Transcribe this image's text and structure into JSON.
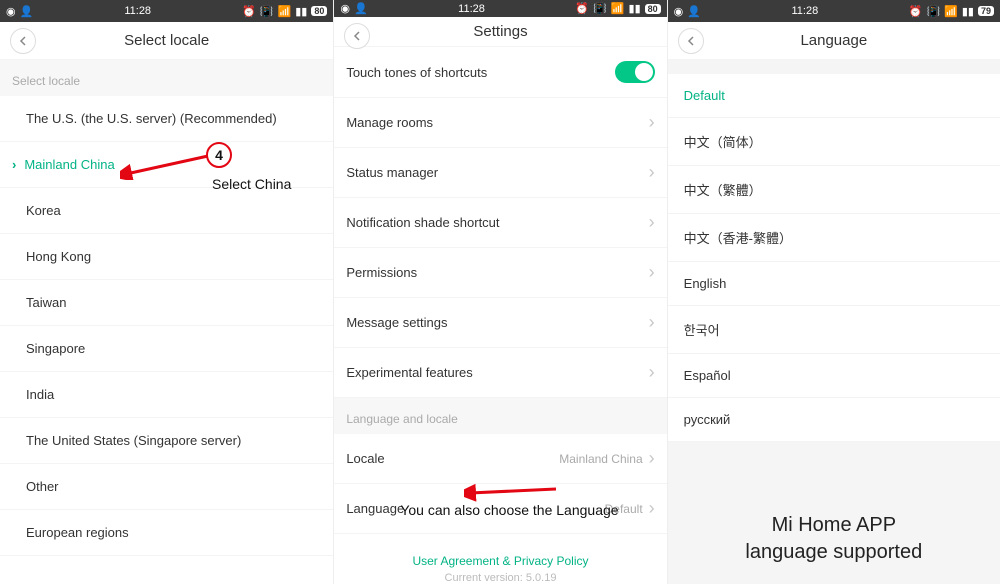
{
  "statusbar": {
    "time": "11:28",
    "battery1": "80",
    "battery2": "80",
    "battery3": "79"
  },
  "panel1": {
    "title": "Select locale",
    "section": "Select locale",
    "rows": [
      {
        "label": "The U.S. (the U.S. server) (Recommended)",
        "selected": false
      },
      {
        "label": "Mainland China",
        "selected": true
      },
      {
        "label": "Korea",
        "selected": false
      },
      {
        "label": "Hong Kong",
        "selected": false
      },
      {
        "label": "Taiwan",
        "selected": false
      },
      {
        "label": "Singapore",
        "selected": false
      },
      {
        "label": "India",
        "selected": false
      },
      {
        "label": "The United States (Singapore server)",
        "selected": false
      },
      {
        "label": "Other",
        "selected": false
      },
      {
        "label": "European regions",
        "selected": false
      }
    ],
    "annotation_badge": "4",
    "annotation_text": "Select China"
  },
  "panel2": {
    "title": "Settings",
    "rows1": [
      {
        "label": "Touch tones of shortcuts",
        "type": "toggle"
      },
      {
        "label": "Manage rooms",
        "type": "chev"
      },
      {
        "label": "Status manager",
        "type": "chev"
      },
      {
        "label": "Notification shade shortcut",
        "type": "chev"
      },
      {
        "label": "Permissions",
        "type": "chev"
      },
      {
        "label": "Message settings",
        "type": "chev"
      },
      {
        "label": "Experimental features",
        "type": "chev"
      }
    ],
    "section2": "Language and locale",
    "rows2": [
      {
        "label": "Locale",
        "value": "Mainland China"
      },
      {
        "label": "Language",
        "value": "Default"
      }
    ],
    "footer_link": "User Agreement & Privacy Policy",
    "footer_version": "Current version: 5.0.19",
    "annotation_text": "You can also choose the Language"
  },
  "panel3": {
    "title": "Language",
    "rows": [
      {
        "label": "Default",
        "selected": true
      },
      {
        "label": "中文（简体）",
        "selected": false
      },
      {
        "label": "中文（繁體）",
        "selected": false
      },
      {
        "label": "中文（香港-繁體）",
        "selected": false
      },
      {
        "label": "English",
        "selected": false
      },
      {
        "label": "한국어",
        "selected": false
      },
      {
        "label": "Español",
        "selected": false
      },
      {
        "label": "русский",
        "selected": false
      }
    ],
    "caption_line1": "Mi Home APP",
    "caption_line2": "language supported"
  }
}
